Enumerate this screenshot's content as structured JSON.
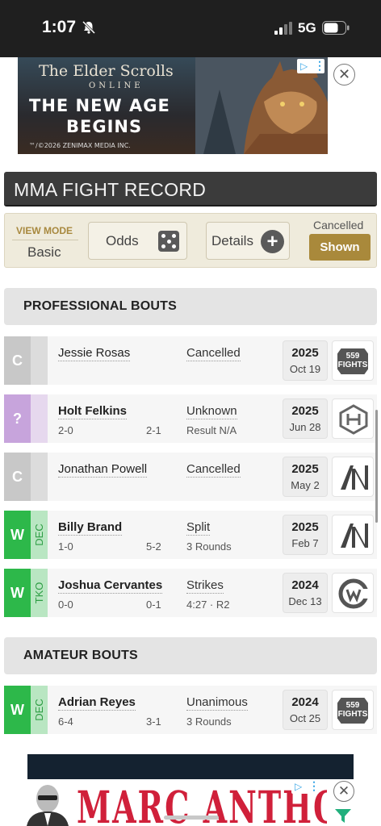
{
  "status_bar": {
    "time": "1:07",
    "network": "5G"
  },
  "ad_top": {
    "line1": "The Elder Scrolls",
    "line2": "ONLINE",
    "line3": "THE NEW AGE",
    "line4": "BEGINS",
    "line5": "™/©2026 ZENIMAX MEDIA INC."
  },
  "page": {
    "title": "MMA FIGHT RECORD"
  },
  "controls": {
    "view_mode_label": "VIEW MODE",
    "view_mode_value": "Basic",
    "odds_label": "Odds",
    "details_label": "Details",
    "cancelled_label": "Cancelled",
    "cancelled_value": "Shown"
  },
  "sections": {
    "professional": "PROFESSIONAL BOUTS",
    "amateur": "AMATEUR BOUTS"
  },
  "colors": {
    "win": "#2db84a",
    "win_method_bg": "#b9e6c2",
    "win_method_text": "#2e9d44",
    "cancelled": "#c8c8c8",
    "cancelled_light": "#dcdcdc",
    "unknown": "#c7a4dc",
    "unknown_light": "#e6d8ee",
    "accent_gold": "#a9893b"
  },
  "pro_bouts": [
    {
      "result": "C",
      "method": "",
      "opponent": "Jessie Rosas",
      "opp_record_a": "",
      "opp_record_b": "",
      "result_main": "Cancelled",
      "result_sub": "",
      "year": "2025",
      "day": "Oct 19",
      "promotion": "559 FIGHTS"
    },
    {
      "result": "?",
      "method": "",
      "opponent": "Holt Felkins",
      "opp_record_a": "2-0",
      "opp_record_b": "2-1",
      "result_main": "Unknown",
      "result_sub": "Result N/A",
      "year": "2025",
      "day": "Jun 28",
      "promotion": "hex-logo"
    },
    {
      "result": "C",
      "method": "",
      "opponent": "Jonathan Powell",
      "opp_record_a": "",
      "opp_record_b": "",
      "result_main": "Cancelled",
      "result_sub": "",
      "year": "2025",
      "day": "May 2",
      "promotion": "an-logo"
    },
    {
      "result": "W",
      "method": "DEC",
      "opponent": "Billy Brand",
      "opp_record_a": "1-0",
      "opp_record_b": "5-2",
      "result_main": "Split",
      "result_sub": "3 Rounds",
      "year": "2025",
      "day": "Feb 7",
      "promotion": "an-logo"
    },
    {
      "result": "W",
      "method": "TKO",
      "opponent": "Joshua Cervantes",
      "opp_record_a": "0-0",
      "opp_record_b": "0-1",
      "result_main": "Strikes",
      "result_sub": "4:27 · R2",
      "year": "2024",
      "day": "Dec 13",
      "promotion": "cw-logo"
    }
  ],
  "am_bouts": [
    {
      "result": "W",
      "method": "DEC",
      "opponent": "Adrian Reyes",
      "opp_record_a": "6-4",
      "opp_record_b": "3-1",
      "result_main": "Unanimous",
      "result_sub": "3 Rounds",
      "year": "2024",
      "day": "Oct 25",
      "promotion": "559 FIGHTS"
    }
  ],
  "ad_bottom": {
    "text": "MARC ANTHONY"
  }
}
